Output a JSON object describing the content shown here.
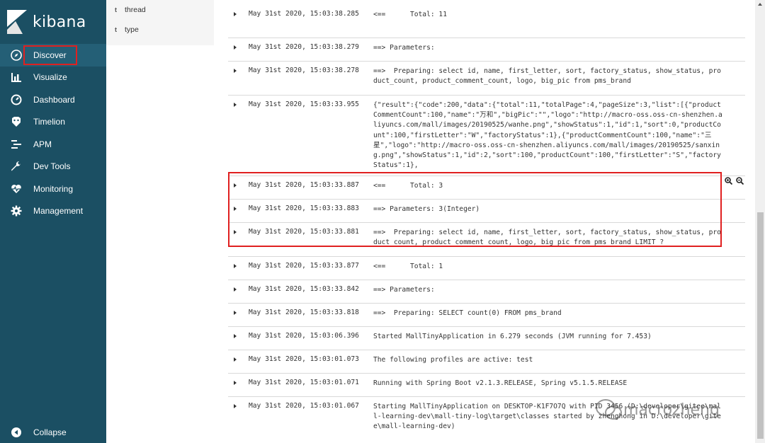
{
  "app": {
    "brand": "kibana"
  },
  "sidebar": {
    "items": [
      {
        "label": "Discover",
        "icon": "compass-icon"
      },
      {
        "label": "Visualize",
        "icon": "bar-chart-icon"
      },
      {
        "label": "Dashboard",
        "icon": "dashboard-icon"
      },
      {
        "label": "Timelion",
        "icon": "timelion-icon"
      },
      {
        "label": "APM",
        "icon": "apm-icon"
      },
      {
        "label": "Dev Tools",
        "icon": "wrench-icon"
      },
      {
        "label": "Monitoring",
        "icon": "heartbeat-icon"
      },
      {
        "label": "Management",
        "icon": "gear-icon"
      }
    ],
    "collapse_label": "Collapse"
  },
  "fields": [
    {
      "type": "t",
      "name": "thread"
    },
    {
      "type": "t",
      "name": "type"
    }
  ],
  "rows": [
    {
      "time": "May 31st 2020, 15:03:38.285",
      "message": "<==      Total: 11"
    },
    {
      "time": "May 31st 2020, 15:03:38.279",
      "message": "==> Parameters: "
    },
    {
      "time": "May 31st 2020, 15:03:38.278",
      "message": "==>  Preparing: select id, name, first_letter, sort, factory_status, show_status, product_count, product_comment_count, logo, big_pic from pms_brand"
    },
    {
      "time": "May 31st 2020, 15:03:33.955",
      "message": "{\"result\":{\"code\":200,\"data\":{\"total\":11,\"totalPage\":4,\"pageSize\":3,\"list\":[{\"productCommentCount\":100,\"name\":\"万和\",\"bigPic\":\"\",\"logo\":\"http://macro-oss.oss-cn-shenzhen.aliyuncs.com/mall/images/20190525/wanhe.png\",\"showStatus\":1,\"id\":1,\"sort\":0,\"productCount\":100,\"firstLetter\":\"W\",\"factoryStatus\":1},{\"productCommentCount\":100,\"name\":\"三星\",\"logo\":\"http://macro-oss.oss-cn-shenzhen.aliyuncs.com/mall/images/20190525/sanxing.png\",\"showStatus\":1,\"id\":2,\"sort\":100,\"productCount\":100,\"firstLetter\":\"S\",\"factoryStatus\":1},"
    },
    {
      "time": "May 31st 2020, 15:03:33.887",
      "message": "<==      Total: 3"
    },
    {
      "time": "May 31st 2020, 15:03:33.883",
      "message": "==> Parameters: 3(Integer)"
    },
    {
      "time": "May 31st 2020, 15:03:33.881",
      "message": "==>  Preparing: select id, name, first_letter, sort, factory_status, show_status, product_count, product_comment_count, logo, big_pic from pms_brand LIMIT ?"
    },
    {
      "time": "May 31st 2020, 15:03:33.877",
      "message": "<==      Total: 1"
    },
    {
      "time": "May 31st 2020, 15:03:33.842",
      "message": "==> Parameters: "
    },
    {
      "time": "May 31st 2020, 15:03:33.818",
      "message": "==>  Preparing: SELECT count(0) FROM pms_brand"
    },
    {
      "time": "May 31st 2020, 15:03:06.396",
      "message": "Started MallTinyApplication in 6.279 seconds (JVM running for 7.453)"
    },
    {
      "time": "May 31st 2020, 15:03:01.073",
      "message": "The following profiles are active: test"
    },
    {
      "time": "May 31st 2020, 15:03:01.071",
      "message": "Running with Spring Boot v2.1.3.RELEASE, Spring v5.1.5.RELEASE"
    },
    {
      "time": "May 31st 2020, 15:03:01.067",
      "message": "Starting MallTinyApplication on DESKTOP-K1F7O7Q with PID 3456 (D:\\developer\\gitee\\mall-learning-dev\\mall-tiny-log\\target\\classes started by zhenghong in D:\\developer\\gitee\\mall-learning-dev)"
    }
  ],
  "watermark": "macrozheng",
  "colors": {
    "sidebar": "#1b4f63",
    "active": "#245f76",
    "highlight": "#e02020"
  }
}
